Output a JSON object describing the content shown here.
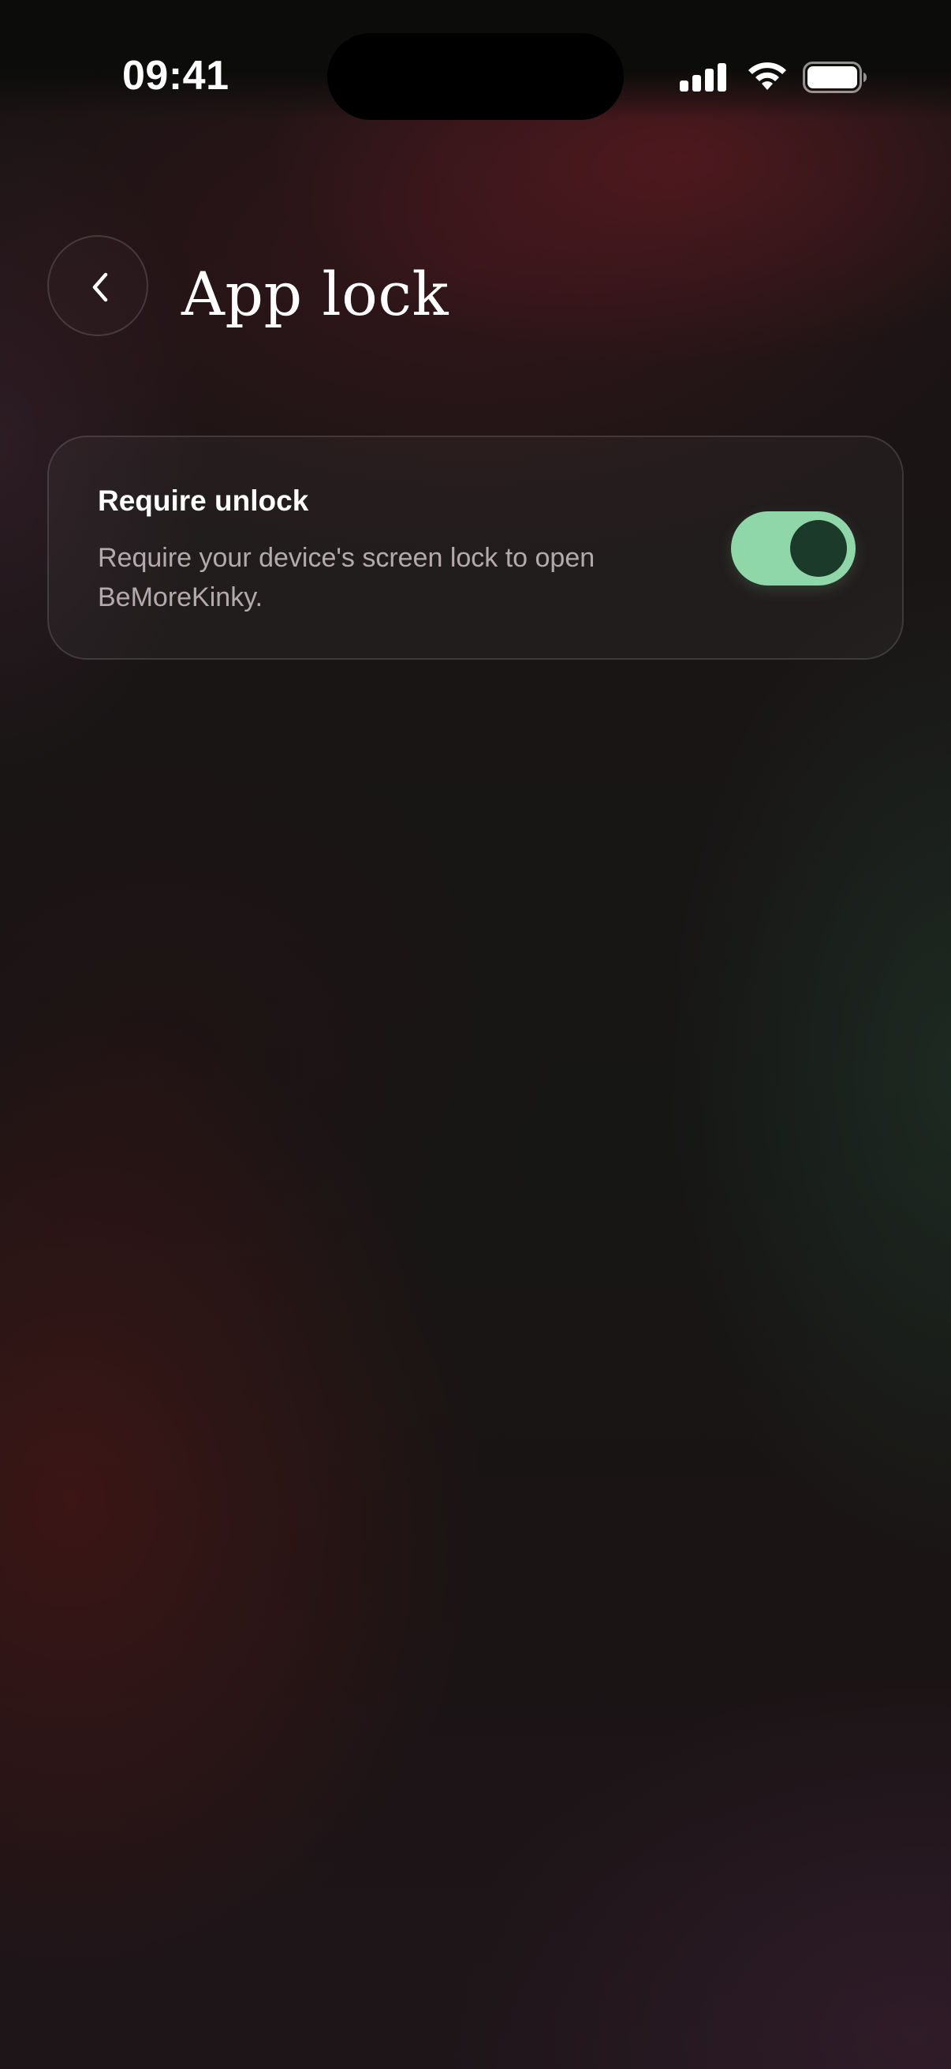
{
  "status_bar": {
    "time": "09:41"
  },
  "header": {
    "back_icon": "chevron-left-icon",
    "title": "App lock"
  },
  "settings": [
    {
      "title": "Require unlock",
      "description": "Require your device's screen lock to open BeMoreKinky.",
      "enabled": true
    }
  ],
  "colors": {
    "toggle_on": "#8fd6a9",
    "toggle_knob": "#1b3a2a",
    "background": "#141313"
  }
}
